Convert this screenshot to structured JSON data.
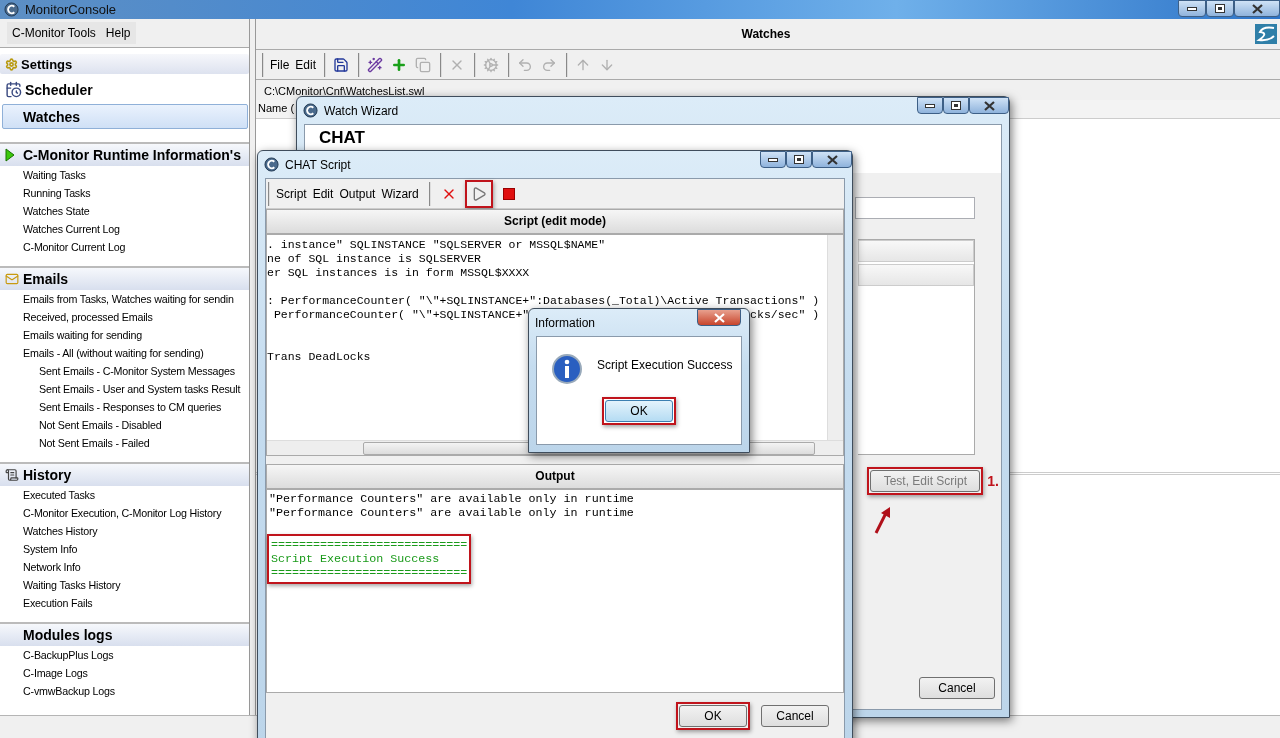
{
  "window": {
    "title": "MonitorConsole"
  },
  "menu": [
    "C-Monitor Tools",
    "Help"
  ],
  "nav": [
    {
      "label": "Settings",
      "kind": "settings",
      "selected": false
    },
    {
      "label": "Scheduler",
      "kind": "scheduler",
      "selected": false
    },
    {
      "label": "Watches",
      "kind": "plain",
      "selected": true
    }
  ],
  "sections": [
    {
      "title": "C-Monitor Runtime Information's",
      "kind": "runtime",
      "items": [
        {
          "label": "Waiting Tasks"
        },
        {
          "label": "Running Tasks"
        },
        {
          "label": "Watches State"
        },
        {
          "label": "Watches Current Log"
        },
        {
          "label": "C-Monitor Current Log"
        }
      ]
    },
    {
      "title": "Emails",
      "kind": "emails",
      "items": [
        {
          "label": "Emails from Tasks, Watches waiting for sendin"
        },
        {
          "label": "Received, processed Emails"
        },
        {
          "label": "Emails waiting for sending"
        },
        {
          "label": "Emails - All (without waiting for sending)",
          "children": [
            {
              "label": "Sent Emails - C-Monitor System Messages"
            },
            {
              "label": "Sent Emails - User and System tasks Result"
            },
            {
              "label": "Sent Emails - Responses to CM queries"
            },
            {
              "label": "Not Sent Emails - Disabled"
            },
            {
              "label": "Not Sent Emails - Failed"
            }
          ]
        }
      ]
    },
    {
      "title": "History",
      "kind": "history",
      "items": [
        {
          "label": "Executed Tasks"
        },
        {
          "label": "C-Monitor Execution, C-Monitor Log History"
        },
        {
          "label": "Watches History"
        },
        {
          "label": "System Info"
        },
        {
          "label": "Network Info"
        },
        {
          "label": "Waiting Tasks History"
        },
        {
          "label": "Execution Fails"
        }
      ]
    },
    {
      "title": "Modules logs",
      "kind": "modules",
      "items": [
        {
          "label": "C-BackupPlus Logs"
        },
        {
          "label": "C-Image Logs"
        },
        {
          "label": "C-vmwBackup Logs"
        }
      ]
    }
  ],
  "main": {
    "title": "Watches",
    "menu": [
      "File",
      "Edit"
    ],
    "toolbar_groups": [
      [
        {
          "kind": "save",
          "disabled": false
        }
      ],
      [
        {
          "kind": "wand",
          "disabled": false
        },
        {
          "kind": "add",
          "disabled": false
        },
        {
          "kind": "copy",
          "disabled": true
        }
      ],
      [
        {
          "kind": "delete",
          "disabled": true
        }
      ],
      [
        {
          "kind": "gear",
          "disabled": true
        }
      ],
      [
        {
          "kind": "undo",
          "disabled": true
        },
        {
          "kind": "redo",
          "disabled": true
        }
      ],
      [
        {
          "kind": "up",
          "disabled": true
        },
        {
          "kind": "down",
          "disabled": true
        }
      ]
    ],
    "path": "C:\\CMonitor\\Cnf\\WatchesList.swl",
    "columns": [
      "Name ("
    ]
  },
  "wizard": {
    "title": "Watch Wizard",
    "heading": "CHAT",
    "test_button": {
      "label": "Test, Edit Script",
      "highlighted": true
    },
    "step": "1.",
    "cancel": "Cancel"
  },
  "chat": {
    "title": "CHAT Script",
    "menu": [
      "Script",
      "Edit",
      "Output",
      "Wizard"
    ],
    "tools": [
      {
        "kind": "delete",
        "highlighted": false
      },
      {
        "kind": "run",
        "highlighted": true
      },
      {
        "kind": "stop",
        "highlighted": false
      }
    ],
    "script_title": "Script (edit mode)",
    "script": [
      {
        "kind": "line",
        "parts": [
          ". instance\" SQLINSTANCE \"SQLSERVER or MSSQL$NAME\""
        ]
      },
      {
        "kind": "line",
        "parts": [
          "ne of SQL instance is SQLSERVER"
        ]
      },
      {
        "kind": "line",
        "parts": [
          "er SQL instances is in form MSSQL$XXXX"
        ]
      },
      {
        "kind": "blank"
      },
      {
        "kind": "line",
        "parts": [
          ": PerformanceCounter( \"\\\"+SQLINSTANCE+\":Databases(_Total)\\Active Transactions\" )"
        ]
      },
      {
        "kind": "line",
        "parts": [
          " PerformanceCounter( \"\\\"+SQLINSTANCE+\"",
          "cks/sec\" )"
        ]
      },
      {
        "kind": "blank"
      },
      {
        "kind": "blank"
      },
      {
        "kind": "line",
        "parts": [
          "Trans DeadLocks"
        ]
      }
    ],
    "output_title": "Output",
    "output": {
      "lines": [
        "\"Performance Counters\" are available only in runtime",
        "\"Performance Counters\" are available only in runtime"
      ],
      "result": {
        "highlighted": true,
        "lines": [
          "============================",
          "Script Execution Success",
          "============================"
        ]
      }
    },
    "buttons": [
      {
        "label": "OK",
        "highlighted": true
      },
      {
        "label": "Cancel",
        "highlighted": false
      }
    ]
  },
  "dialog": {
    "title": "Information",
    "message": "Script Execution Success",
    "button": {
      "label": "OK",
      "highlighted": true
    }
  }
}
